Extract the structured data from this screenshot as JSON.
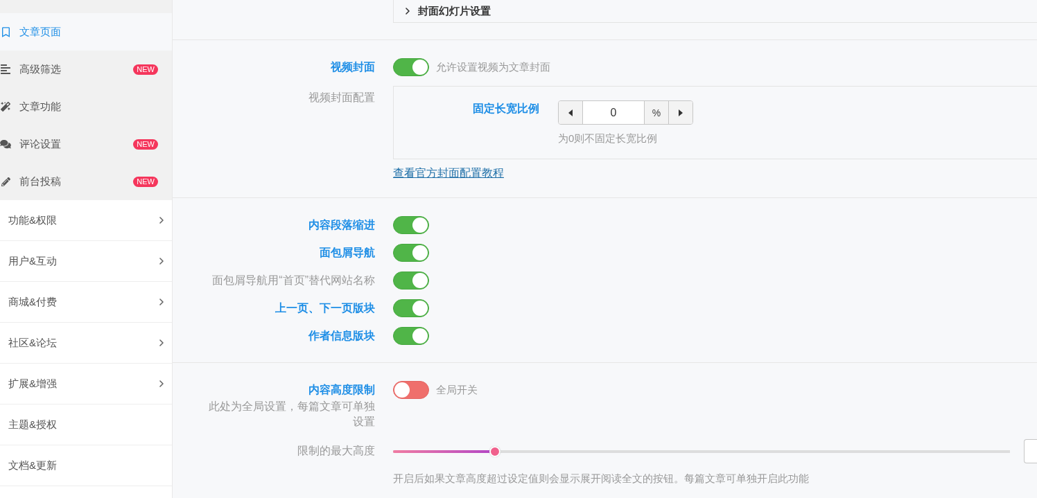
{
  "sidebar": {
    "submenu": [
      {
        "label": "文章页面",
        "selected": true
      },
      {
        "label": "高级筛选",
        "selected": false,
        "badge": "NEW"
      },
      {
        "label": "文章功能",
        "selected": false
      },
      {
        "label": "评论设置",
        "selected": false,
        "badge": "NEW"
      },
      {
        "label": "前台投稿",
        "selected": false,
        "badge": "NEW"
      }
    ],
    "items": [
      {
        "label": "功能&权限",
        "has_submenu": true
      },
      {
        "label": "用户&互动",
        "has_submenu": true
      },
      {
        "label": "商城&付费",
        "has_submenu": true
      },
      {
        "label": "社区&论坛",
        "has_submenu": true
      },
      {
        "label": "扩展&增强",
        "has_submenu": true
      },
      {
        "label": "主题&授权",
        "has_submenu": false
      },
      {
        "label": "文档&更新",
        "has_submenu": false
      }
    ]
  },
  "collapsed_panel": {
    "title": "封面幻灯片设置",
    "expanded": false
  },
  "sections": [
    {
      "rows": [
        {
          "kind": "switch",
          "label": "视频封面",
          "primary": true,
          "on": true,
          "description": "允许设置视频为文章封面"
        },
        {
          "kind": "group",
          "label": "视频封面配置",
          "primary": false,
          "fields": [
            {
              "label": "固定长宽比例",
              "primary": true,
              "value": "0",
              "unit": "%",
              "hint": "为0则不固定长宽比例"
            }
          ],
          "link": "查看官方封面配置教程"
        }
      ]
    },
    {
      "rows": [
        {
          "kind": "switch",
          "label": "内容段落缩进",
          "primary": true,
          "on": true
        },
        {
          "kind": "switch",
          "label": "面包屑导航",
          "primary": true,
          "on": true
        },
        {
          "kind": "switch",
          "label": "面包屑导航用“首页”替代网站名称",
          "primary": false,
          "on": true
        },
        {
          "kind": "switch",
          "label": "上一页、下一页版块",
          "primary": true,
          "on": true
        },
        {
          "kind": "switch",
          "label": "作者信息版块",
          "primary": true,
          "on": true
        }
      ]
    },
    {
      "rows": [
        {
          "kind": "switch",
          "label": "内容高度限制",
          "primary": true,
          "note": "此处为全局设置，每篇文章可单独设置",
          "on": false,
          "description": "全局开关"
        },
        {
          "kind": "slider",
          "label": "限制的最大高度",
          "primary": false,
          "level": 0.165,
          "description": "开启后如果文章高度超过设定值则会显示展开阅读全文的按钮。每篇文章可单独开启此功能"
        }
      ]
    }
  ]
}
